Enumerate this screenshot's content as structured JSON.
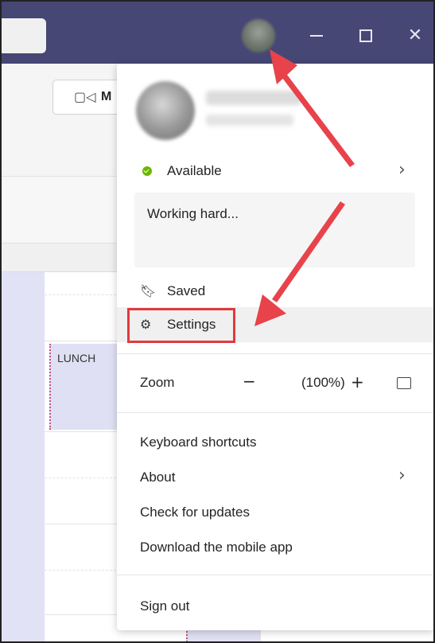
{
  "menu": {
    "presence": {
      "label": "Available",
      "color": "#6bb700"
    },
    "status_message": "Working hard...",
    "saved_label": "Saved",
    "settings_label": "Settings",
    "zoom": {
      "label": "Zoom",
      "minus": "−",
      "value": "(100%)",
      "plus": "+"
    },
    "keyboard_shortcuts_label": "Keyboard shortcuts",
    "about_label": "About",
    "check_updates_label": "Check for updates",
    "download_mobile_label": "Download the mobile app",
    "sign_out_label": "Sign out"
  },
  "background": {
    "meet_label": "M",
    "calendar_event": "LUNCH"
  },
  "colors": {
    "titlebar": "#464775",
    "highlight": "#e03a3e",
    "arrow": "#e8424b"
  }
}
